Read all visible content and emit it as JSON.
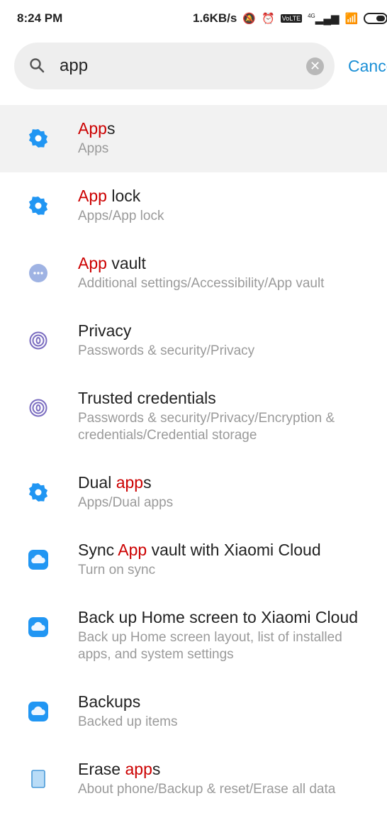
{
  "status": {
    "time": "8:24 PM",
    "speed": "1.6KB/s",
    "network": "4G",
    "battery": "3"
  },
  "search": {
    "value": "app",
    "cancel": "Cancel"
  },
  "colors": {
    "highlight": "#cc0000",
    "accent": "#1a8fd6",
    "gear": "#2196f3",
    "dots": "#9fb3e3",
    "fingerprint": "#7a6cc0",
    "cloud": "#2196f3"
  },
  "results": [
    {
      "icon": "gear-icon",
      "title": [
        {
          "t": "App",
          "hl": true
        },
        {
          "t": "s",
          "hl": false
        }
      ],
      "sub": [
        "Apps"
      ],
      "selected": true
    },
    {
      "icon": "gear-icon",
      "title": [
        {
          "t": "App",
          "hl": true
        },
        {
          "t": " lock",
          "hl": false
        }
      ],
      "sub": [
        "Apps/App lock"
      ]
    },
    {
      "icon": "more-dots-icon",
      "title": [
        {
          "t": "App",
          "hl": true
        },
        {
          "t": " vault",
          "hl": false
        }
      ],
      "sub": [
        "Additional settings/Accessibility/App vault"
      ]
    },
    {
      "icon": "fingerprint-icon",
      "title": [
        {
          "t": "Privacy",
          "hl": false
        }
      ],
      "sub": [
        "Passwords & security/Privacy"
      ]
    },
    {
      "icon": "fingerprint-icon",
      "title": [
        {
          "t": "Trusted credentials",
          "hl": false
        }
      ],
      "sub": [
        "Passwords & security/Privacy/Encryption &",
        "credentials/Credential storage"
      ]
    },
    {
      "icon": "gear-icon",
      "title": [
        {
          "t": "Dual ",
          "hl": false
        },
        {
          "t": "app",
          "hl": true
        },
        {
          "t": "s",
          "hl": false
        }
      ],
      "sub": [
        "Apps/Dual apps"
      ]
    },
    {
      "icon": "cloud-icon",
      "title": [
        {
          "t": "Sync ",
          "hl": false
        },
        {
          "t": "App",
          "hl": true
        },
        {
          "t": " vault with Xiaomi Cloud",
          "hl": false
        }
      ],
      "sub": [
        "Turn on sync"
      ]
    },
    {
      "icon": "cloud-icon",
      "title": [
        {
          "t": "Back up Home screen to Xiaomi Cloud",
          "hl": false
        }
      ],
      "sub": [
        "Back up Home screen layout, list of installed",
        "apps, and system settings"
      ]
    },
    {
      "icon": "cloud-icon",
      "title": [
        {
          "t": "Backups",
          "hl": false
        }
      ],
      "sub": [
        "Backed up items"
      ]
    },
    {
      "icon": "phone-icon",
      "title": [
        {
          "t": "Erase ",
          "hl": false
        },
        {
          "t": "app",
          "hl": true
        },
        {
          "t": "s",
          "hl": false
        }
      ],
      "sub": [
        "About phone/Backup & reset/Erase all data"
      ]
    }
  ]
}
